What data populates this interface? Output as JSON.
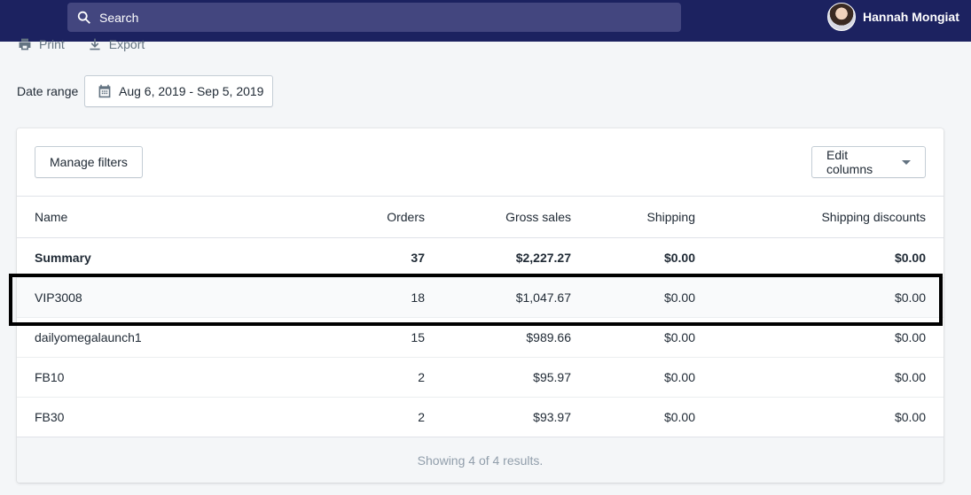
{
  "topbar": {
    "search_placeholder": "Search",
    "user_name": "Hannah Mongiat"
  },
  "actions": {
    "print_label": "Print",
    "export_label": "Export"
  },
  "date_range": {
    "label": "Date range",
    "value": "Aug 6, 2019 - Sep 5, 2019"
  },
  "card": {
    "manage_filters": "Manage filters",
    "edit_columns": "Edit columns"
  },
  "table": {
    "headers": {
      "name": "Name",
      "orders": "Orders",
      "gross_sales": "Gross sales",
      "shipping": "Shipping",
      "shipping_discounts": "Shipping discounts"
    },
    "rows": [
      {
        "name": "Summary",
        "orders": "37",
        "gross_sales": "$2,227.27",
        "shipping": "$0.00",
        "shipping_discounts": "$0.00"
      },
      {
        "name": "VIP3008",
        "orders": "18",
        "gross_sales": "$1,047.67",
        "shipping": "$0.00",
        "shipping_discounts": "$0.00"
      },
      {
        "name": "dailyomegalaunch1",
        "orders": "15",
        "gross_sales": "$989.66",
        "shipping": "$0.00",
        "shipping_discounts": "$0.00"
      },
      {
        "name": "FB10",
        "orders": "2",
        "gross_sales": "$95.97",
        "shipping": "$0.00",
        "shipping_discounts": "$0.00"
      },
      {
        "name": "FB30",
        "orders": "2",
        "gross_sales": "$93.97",
        "shipping": "$0.00",
        "shipping_discounts": "$0.00"
      }
    ],
    "footer": "Showing 4 of 4 results."
  },
  "colors": {
    "topbar": "#1c2260",
    "search_bg": "#43467f",
    "highlight_border": "#000000"
  }
}
